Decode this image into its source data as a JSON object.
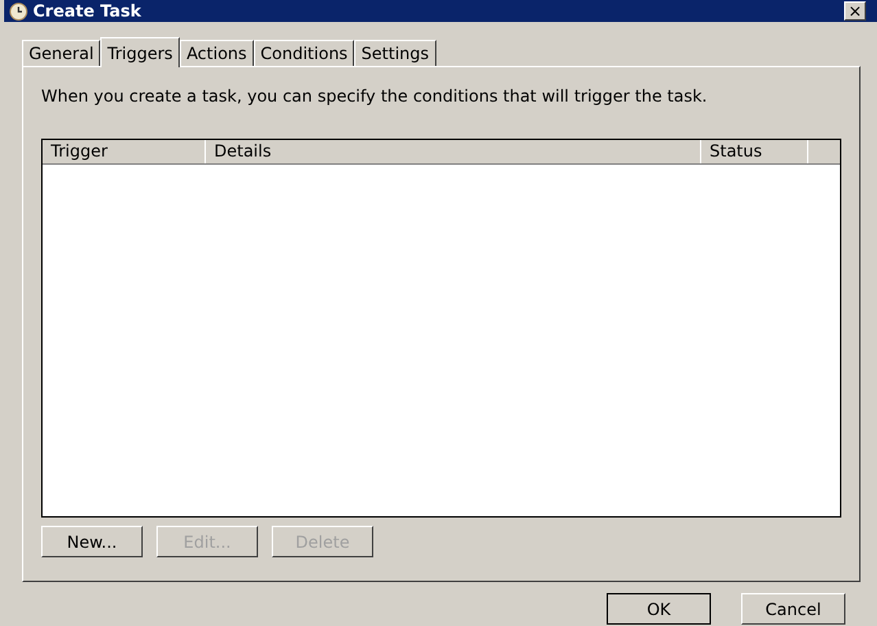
{
  "window": {
    "title": "Create Task",
    "close": "×"
  },
  "tabs": [
    {
      "label": "General",
      "selected": false
    },
    {
      "label": "Triggers",
      "selected": true
    },
    {
      "label": "Actions",
      "selected": false
    },
    {
      "label": "Conditions",
      "selected": false
    },
    {
      "label": "Settings",
      "selected": false
    }
  ],
  "description": "When you create a task, you can specify the conditions that will trigger the task.",
  "table": {
    "columns": [
      "Trigger",
      "Details",
      "Status"
    ]
  },
  "buttons": [
    {
      "label": "New...",
      "disabled": false
    },
    {
      "label": "Edit...",
      "disabled": true
    },
    {
      "label": "Delete",
      "disabled": true
    }
  ],
  "dialog_buttons": [
    "OK",
    "Cancel"
  ]
}
